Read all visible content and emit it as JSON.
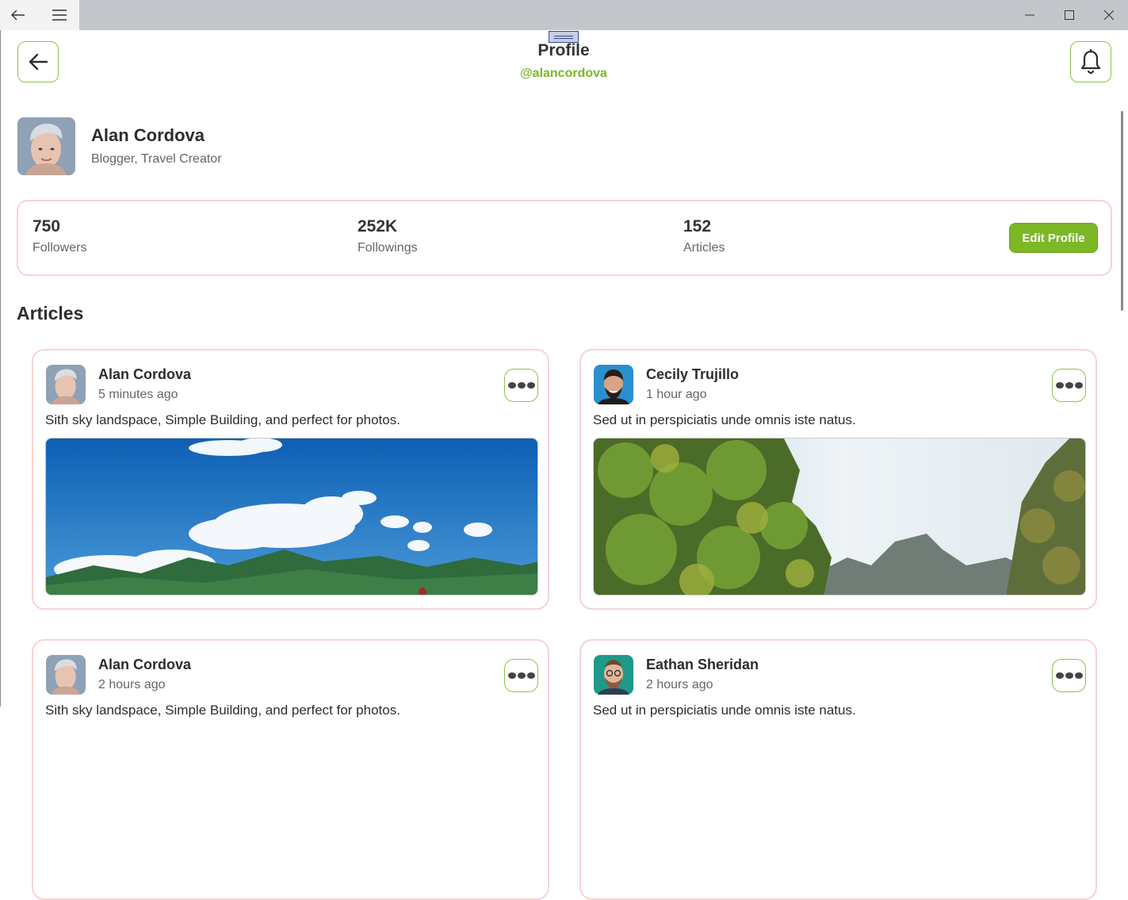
{
  "window": {
    "icons": {
      "back": "arrow-left-icon",
      "menu": "hamburger-icon",
      "minimize": "minimize-icon",
      "maximize": "maximize-icon",
      "close": "close-icon"
    }
  },
  "header": {
    "title": "Profile",
    "handle": "@alancordova",
    "back_icon": "arrow-left-icon",
    "bell_icon": "bell-icon",
    "accent": "#7cb726"
  },
  "profile": {
    "name": "Alan Cordova",
    "role": "Blogger, Travel Creator"
  },
  "stats": [
    {
      "value": "750",
      "label": "Followers"
    },
    {
      "value": "252K",
      "label": "Followings"
    },
    {
      "value": "152",
      "label": "Articles"
    }
  ],
  "edit_profile_label": "Edit Profile",
  "articles_title": "Articles",
  "articles": [
    {
      "author": "Alan Cordova",
      "time": "5 minutes ago",
      "text": "Sith sky landspace, Simple Building, and perfect for photos.",
      "image": "sky-mountains-photo"
    },
    {
      "author": "Cecily Trujillo",
      "time": "1 hour ago",
      "text": "Sed ut in perspiciatis unde omnis iste natus.",
      "image": "jungle-cliffs-photo"
    },
    {
      "author": "Alan Cordova",
      "time": "2 hours ago",
      "text": "Sith sky landspace, Simple Building, and perfect for photos.",
      "image": ""
    },
    {
      "author": "Eathan Sheridan",
      "time": "2 hours ago",
      "text": "Sed ut in perspiciatis unde omnis iste natus.",
      "image": ""
    }
  ]
}
